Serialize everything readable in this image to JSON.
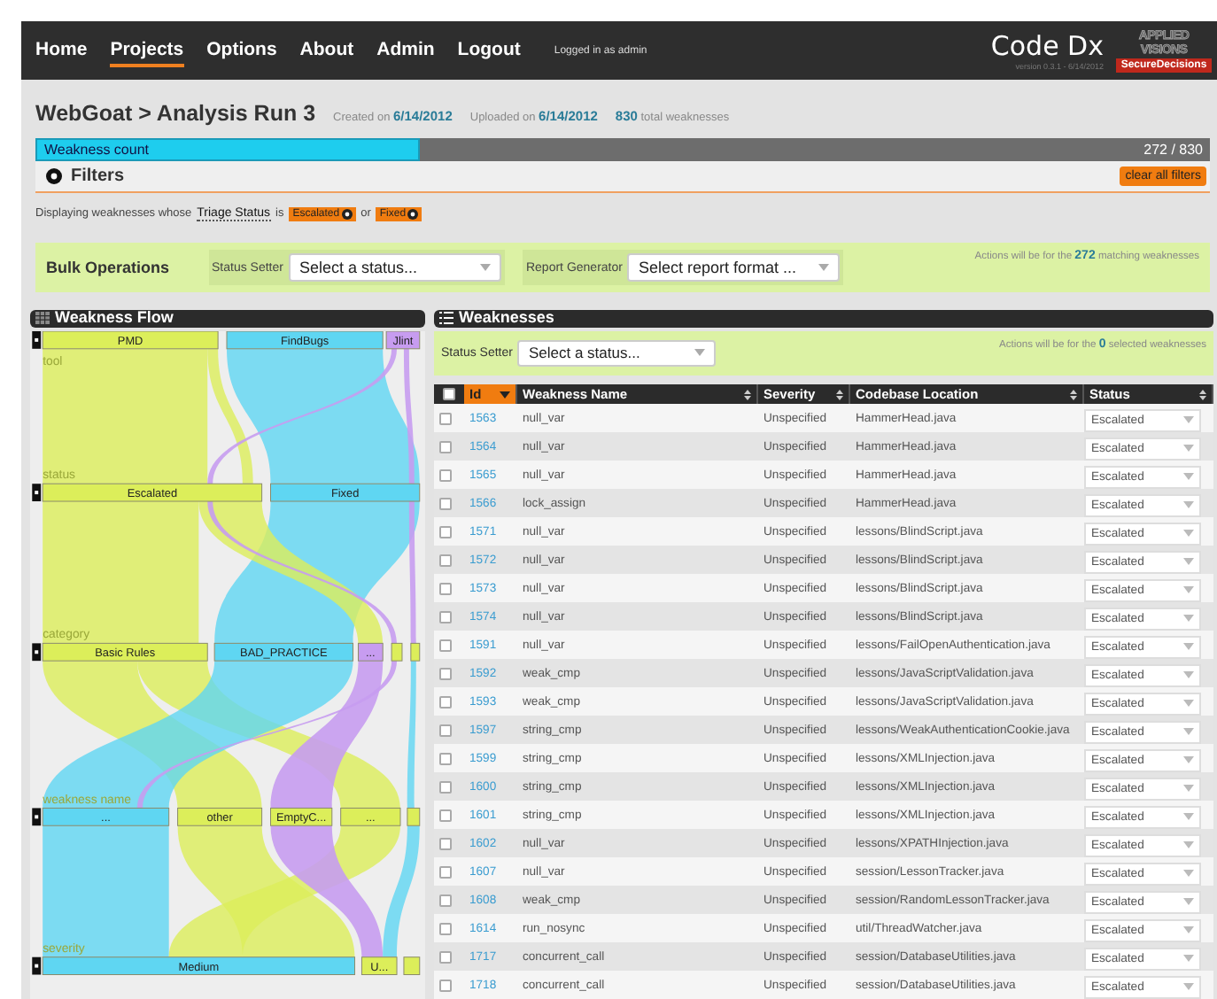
{
  "nav": {
    "items": [
      {
        "label": "Home",
        "selected": false
      },
      {
        "label": "Projects",
        "selected": true
      },
      {
        "label": "Options",
        "selected": false
      },
      {
        "label": "About",
        "selected": false
      },
      {
        "label": "Admin",
        "selected": false
      },
      {
        "label": "Logout",
        "selected": false
      }
    ],
    "user": "Logged in as admin"
  },
  "brand": {
    "product": "Code Dx",
    "version": "version 0.3.1 - 6/14/2012",
    "vendor": "APPLIED VISIONS",
    "tagline": "SecureDecisions"
  },
  "header": {
    "title": "WebGoat > Analysis Run 3",
    "meta": [
      {
        "label": "Created on",
        "value": "6/14/2012"
      },
      {
        "label": "Uploaded on",
        "value": "6/14/2012"
      }
    ],
    "total": {
      "value": "830",
      "label": "total weaknesses"
    }
  },
  "weakness_count": {
    "label": "Weakness count",
    "level": 0.328,
    "reading": "272 / 830"
  },
  "filters": {
    "title": "Filters",
    "expanded": false,
    "clear_button": "clear all filters",
    "prefix": "Displaying weaknesses whose",
    "field": "Triage Status",
    "verb": "is",
    "chips": [
      "Escalated",
      "Fixed"
    ],
    "joiner": "or"
  },
  "bulk_operations": {
    "title": "Bulk Operations",
    "controls": [
      {
        "label": "Status Setter",
        "placeholder": "Select a status..."
      },
      {
        "label": "Report Generator",
        "placeholder": "Select report format ..."
      }
    ],
    "note": "Actions will be for the **272** matching weaknesses"
  },
  "weakness_flow": {
    "title": "Weakness Flow",
    "levels": [
      {
        "label": "tool",
        "nodes": [
          {
            "label": "PMD",
            "color": "#dcee5a"
          },
          {
            "label": "FindBugs",
            "color": "#5fd6f2"
          },
          {
            "label": "Jlint",
            "color": "#c79cf0"
          }
        ]
      },
      {
        "label": "status",
        "nodes": [
          {
            "label": "Escalated",
            "color": "#dcee5a"
          },
          {
            "label": "Fixed",
            "color": "#5fd6f2"
          }
        ]
      },
      {
        "label": "category",
        "nodes": [
          {
            "label": "Basic Rules",
            "color": "#dcee5a"
          },
          {
            "label": "BAD_PRACTICE",
            "color": "#5fd6f2"
          },
          {
            "label": "...",
            "color": "#c79cf0"
          },
          {
            "color": "#dcee5a"
          },
          {
            "color": "#dcee5a"
          }
        ]
      },
      {
        "label": "weakness name",
        "nodes": [
          {
            "label": "...",
            "color": "#5fd6f2"
          },
          {
            "label": "other",
            "color": "#dcee5a"
          },
          {
            "label": "EmptyC...",
            "color": "#dcee5a"
          },
          {
            "label": "...",
            "color": "#dcee5a"
          },
          {
            "color": "#dcee5a"
          }
        ]
      },
      {
        "label": "severity",
        "nodes": [
          {
            "label": "Medium",
            "color": "#5fd6f2"
          },
          {
            "label": "U...",
            "color": "#dcee5a"
          },
          {
            "color": "#dcee5a"
          }
        ]
      }
    ]
  },
  "weaknesses": {
    "title": "Weaknesses",
    "status_setter": {
      "label": "Status Setter",
      "placeholder": "Select a status..."
    },
    "note": "Actions will be for the **0** selected weaknesses",
    "select_all": {
      "checked": false
    },
    "columns": [
      {
        "label": "Id",
        "sorted": true
      },
      {
        "label": "Weakness Name",
        "sorted": false
      },
      {
        "label": "Severity",
        "sorted": false
      },
      {
        "label": "Codebase Location",
        "sorted": false
      },
      {
        "label": "Status",
        "sorted": false
      }
    ],
    "rows": [
      {
        "checked": false,
        "id": "1563",
        "name": "null_var",
        "severity": "Unspecified",
        "location": "HammerHead.java",
        "status": "Escalated"
      },
      {
        "checked": false,
        "id": "1564",
        "name": "null_var",
        "severity": "Unspecified",
        "location": "HammerHead.java",
        "status": "Escalated"
      },
      {
        "checked": false,
        "id": "1565",
        "name": "null_var",
        "severity": "Unspecified",
        "location": "HammerHead.java",
        "status": "Escalated"
      },
      {
        "checked": false,
        "id": "1566",
        "name": "lock_assign",
        "severity": "Unspecified",
        "location": "HammerHead.java",
        "status": "Escalated"
      },
      {
        "checked": false,
        "id": "1571",
        "name": "null_var",
        "severity": "Unspecified",
        "location": "lessons/BlindScript.java",
        "status": "Escalated"
      },
      {
        "checked": false,
        "id": "1572",
        "name": "null_var",
        "severity": "Unspecified",
        "location": "lessons/BlindScript.java",
        "status": "Escalated"
      },
      {
        "checked": false,
        "id": "1573",
        "name": "null_var",
        "severity": "Unspecified",
        "location": "lessons/BlindScript.java",
        "status": "Escalated"
      },
      {
        "checked": false,
        "id": "1574",
        "name": "null_var",
        "severity": "Unspecified",
        "location": "lessons/BlindScript.java",
        "status": "Escalated"
      },
      {
        "checked": false,
        "id": "1591",
        "name": "null_var",
        "severity": "Unspecified",
        "location": "lessons/FailOpenAuthentication.java",
        "status": "Escalated"
      },
      {
        "checked": false,
        "id": "1592",
        "name": "weak_cmp",
        "severity": "Unspecified",
        "location": "lessons/JavaScriptValidation.java",
        "status": "Escalated"
      },
      {
        "checked": false,
        "id": "1593",
        "name": "weak_cmp",
        "severity": "Unspecified",
        "location": "lessons/JavaScriptValidation.java",
        "status": "Escalated"
      },
      {
        "checked": false,
        "id": "1597",
        "name": "string_cmp",
        "severity": "Unspecified",
        "location": "lessons/WeakAuthenticationCookie.java",
        "status": "Escalated"
      },
      {
        "checked": false,
        "id": "1599",
        "name": "string_cmp",
        "severity": "Unspecified",
        "location": "lessons/XMLInjection.java",
        "status": "Escalated"
      },
      {
        "checked": false,
        "id": "1600",
        "name": "string_cmp",
        "severity": "Unspecified",
        "location": "lessons/XMLInjection.java",
        "status": "Escalated"
      },
      {
        "checked": false,
        "id": "1601",
        "name": "string_cmp",
        "severity": "Unspecified",
        "location": "lessons/XMLInjection.java",
        "status": "Escalated"
      },
      {
        "checked": false,
        "id": "1602",
        "name": "null_var",
        "severity": "Unspecified",
        "location": "lessons/XPATHInjection.java",
        "status": "Escalated"
      },
      {
        "checked": false,
        "id": "1607",
        "name": "null_var",
        "severity": "Unspecified",
        "location": "session/LessonTracker.java",
        "status": "Escalated"
      },
      {
        "checked": false,
        "id": "1608",
        "name": "weak_cmp",
        "severity": "Unspecified",
        "location": "session/RandomLessonTracker.java",
        "status": "Escalated"
      },
      {
        "checked": false,
        "id": "1614",
        "name": "run_nosync",
        "severity": "Unspecified",
        "location": "util/ThreadWatcher.java",
        "status": "Escalated"
      },
      {
        "checked": false,
        "id": "1717",
        "name": "concurrent_call",
        "severity": "Unspecified",
        "location": "session/DatabaseUtilities.java",
        "status": "Escalated"
      },
      {
        "checked": false,
        "id": "1718",
        "name": "concurrent_call",
        "severity": "Unspecified",
        "location": "session/DatabaseUtilities.java",
        "status": "Escalated"
      }
    ]
  }
}
